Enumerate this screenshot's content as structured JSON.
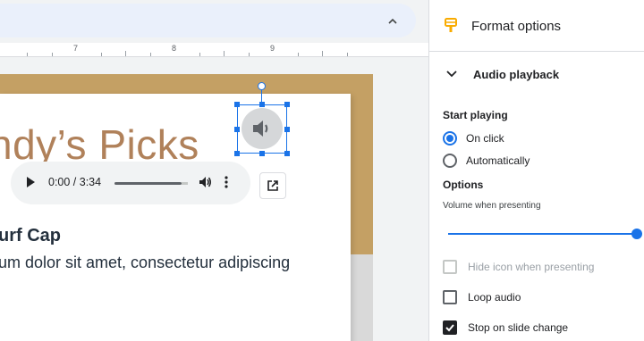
{
  "ruler": {
    "marks": [
      "7",
      "8",
      "9"
    ]
  },
  "slide": {
    "title": "ndy’s Picks",
    "subheading": "urf Cap",
    "body": "um dolor sit amet, consectetur adipiscing"
  },
  "player": {
    "time": "0:00 / 3:34",
    "progress": 0
  },
  "panel": {
    "title": "Format options",
    "section_title": "Audio playback",
    "start_playing_label": "Start playing",
    "start_options": [
      {
        "label": "On click",
        "selected": true
      },
      {
        "label": "Automatically",
        "selected": false
      }
    ],
    "options_label": "Options",
    "volume_label": "Volume when presenting",
    "volume_fraction": 1.0,
    "checkboxes": [
      {
        "label": "Hide icon when presenting",
        "checked": false,
        "disabled": true
      },
      {
        "label": "Loop audio",
        "checked": false,
        "disabled": false
      },
      {
        "label": "Stop on slide change",
        "checked": true,
        "disabled": false
      }
    ]
  },
  "colors": {
    "accent": "#1a73e8",
    "title": "#b0815a",
    "slide_bg": "#c4a064",
    "format_icon": "#f9ab00"
  }
}
